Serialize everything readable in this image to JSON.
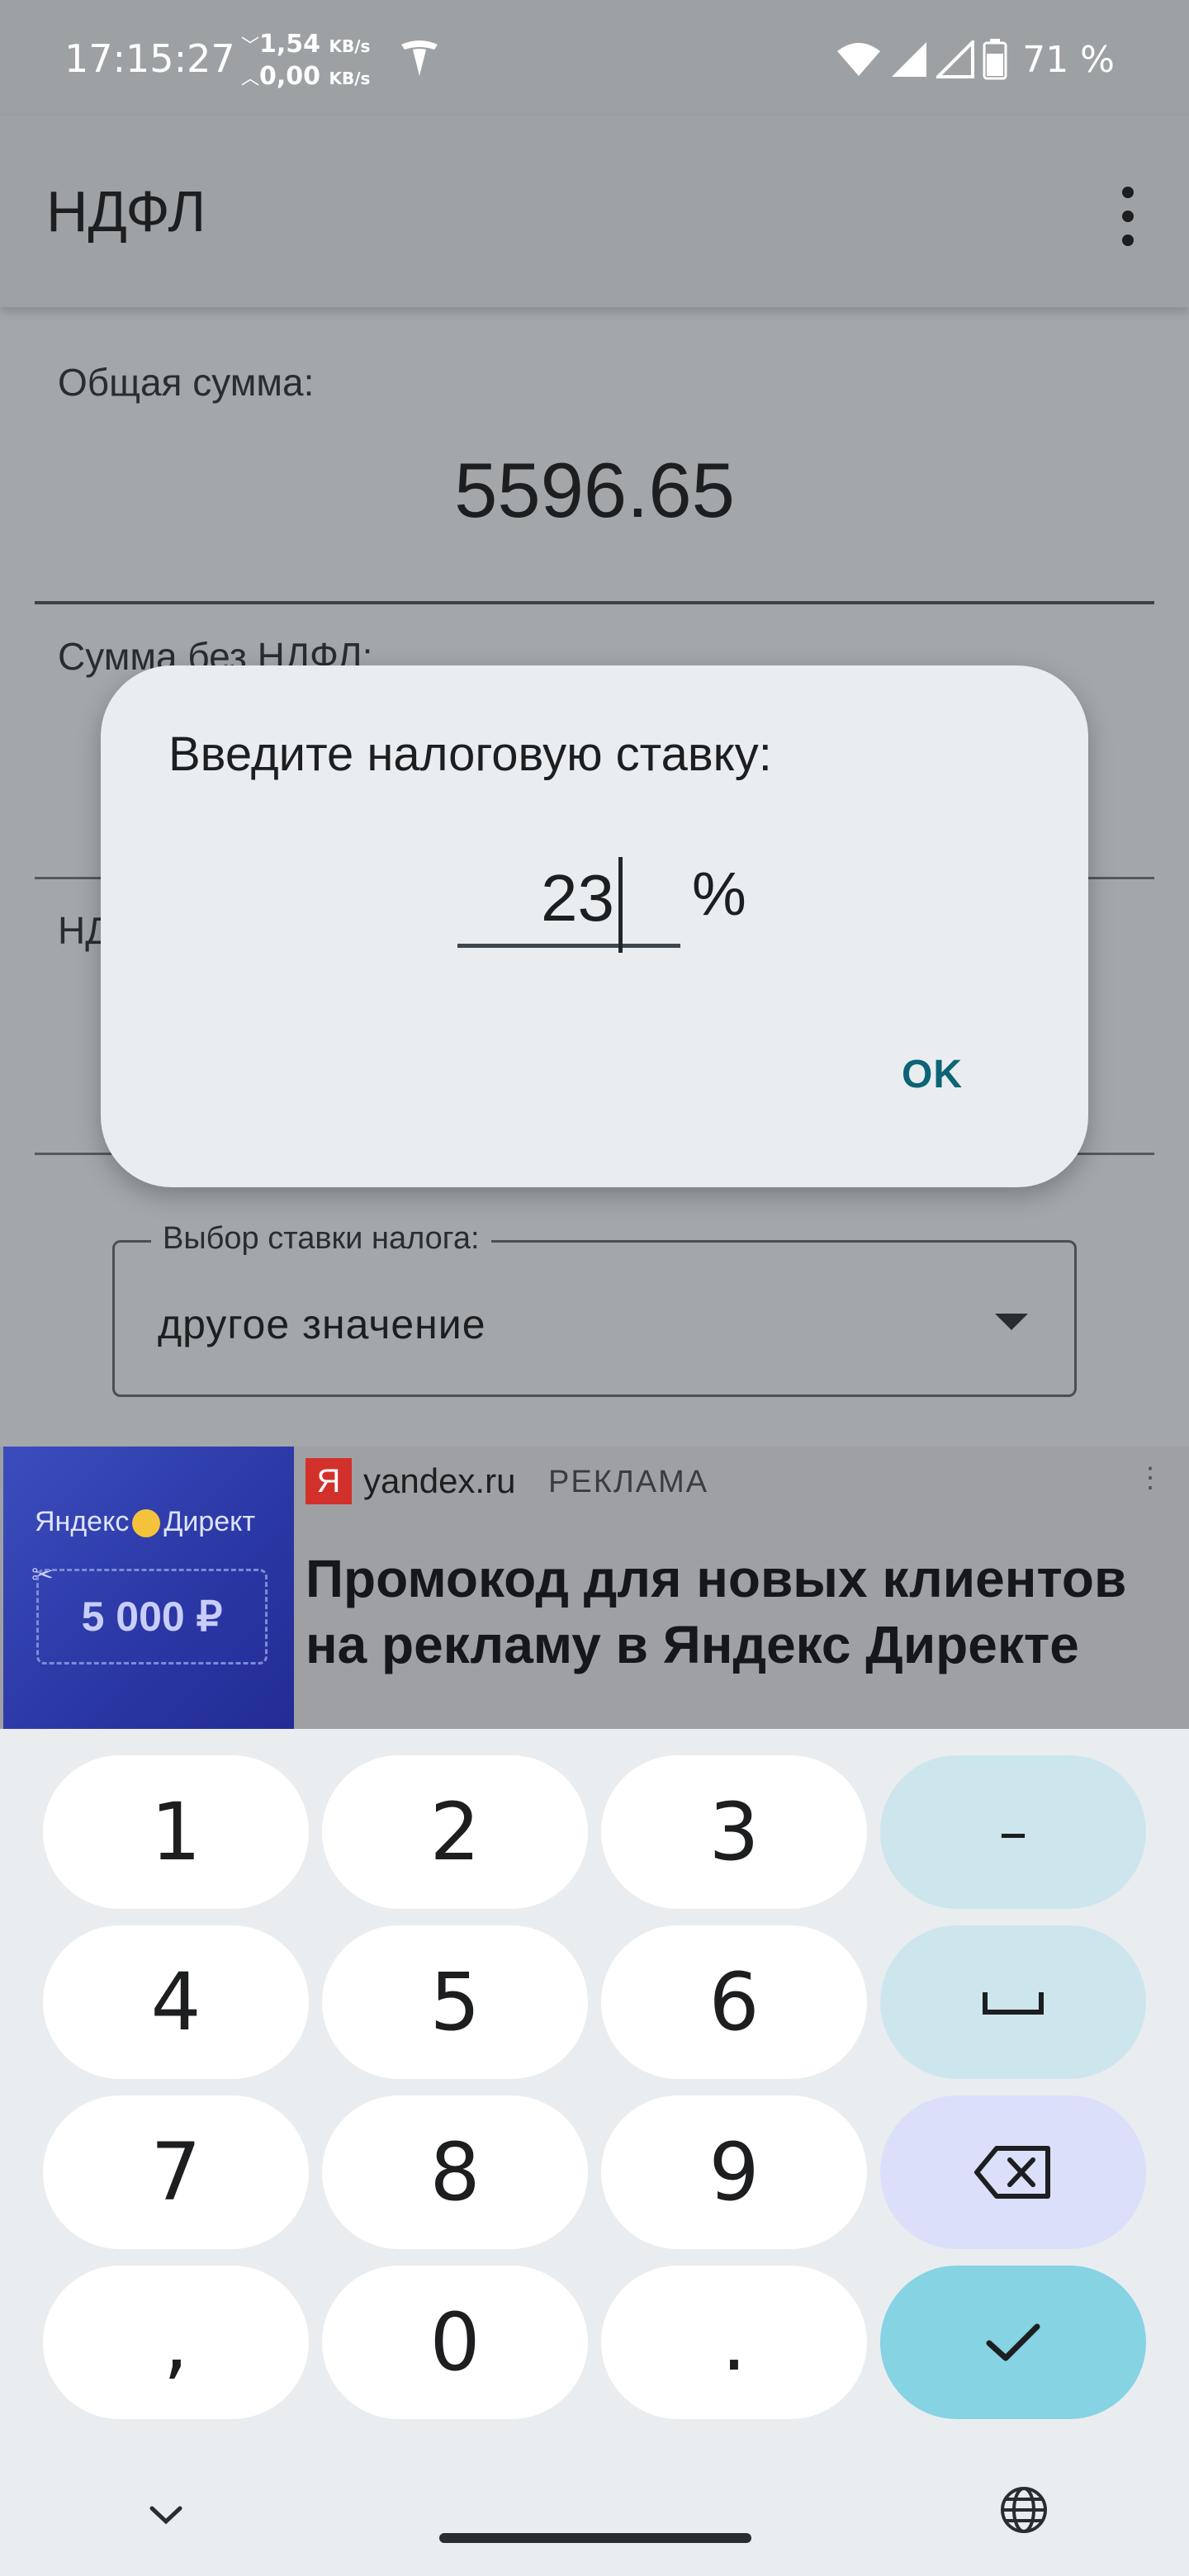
{
  "status_bar": {
    "time": "17:15:27",
    "net_down": "1,54",
    "net_up": "0,00",
    "net_unit": "KB/s",
    "battery": "71 %"
  },
  "app_bar": {
    "title": "НДФЛ"
  },
  "fields": {
    "total_label": "Общая сумма:",
    "total_value": "5596.65",
    "without_tax_label": "Сумма без НДФЛ:",
    "tax_label": "НДФЛ:"
  },
  "rate_select": {
    "legend": "Выбор ставки налога:",
    "value": "другое значение"
  },
  "dialog": {
    "title": "Введите налоговую ставку:",
    "input_value": "23",
    "suffix": "%",
    "ok_label": "OK"
  },
  "ad": {
    "brand": "Яндекс Директ",
    "brand_part1": "Яндекс",
    "brand_part2": "Директ",
    "coupon": "5 000 ₽",
    "favicon": "Я",
    "domain": "yandex.ru",
    "tag": "РЕКЛАМА",
    "headline": "Промокод для новых клиентов на рекламу в Яндекс Директе"
  },
  "keyboard": {
    "keys": [
      "1",
      "2",
      "3",
      "–",
      "4",
      "5",
      "6",
      "␣",
      "7",
      "8",
      "9",
      "⌫",
      ",",
      "0",
      ".",
      "✓"
    ]
  },
  "icons": {
    "wifi": "wifi-icon",
    "signal": "signal-icon",
    "battery": "battery-icon",
    "tesla": "tesla-icon",
    "menu": "overflow-menu-icon",
    "hide_keyboard": "chevron-down-icon",
    "language": "globe-icon"
  }
}
